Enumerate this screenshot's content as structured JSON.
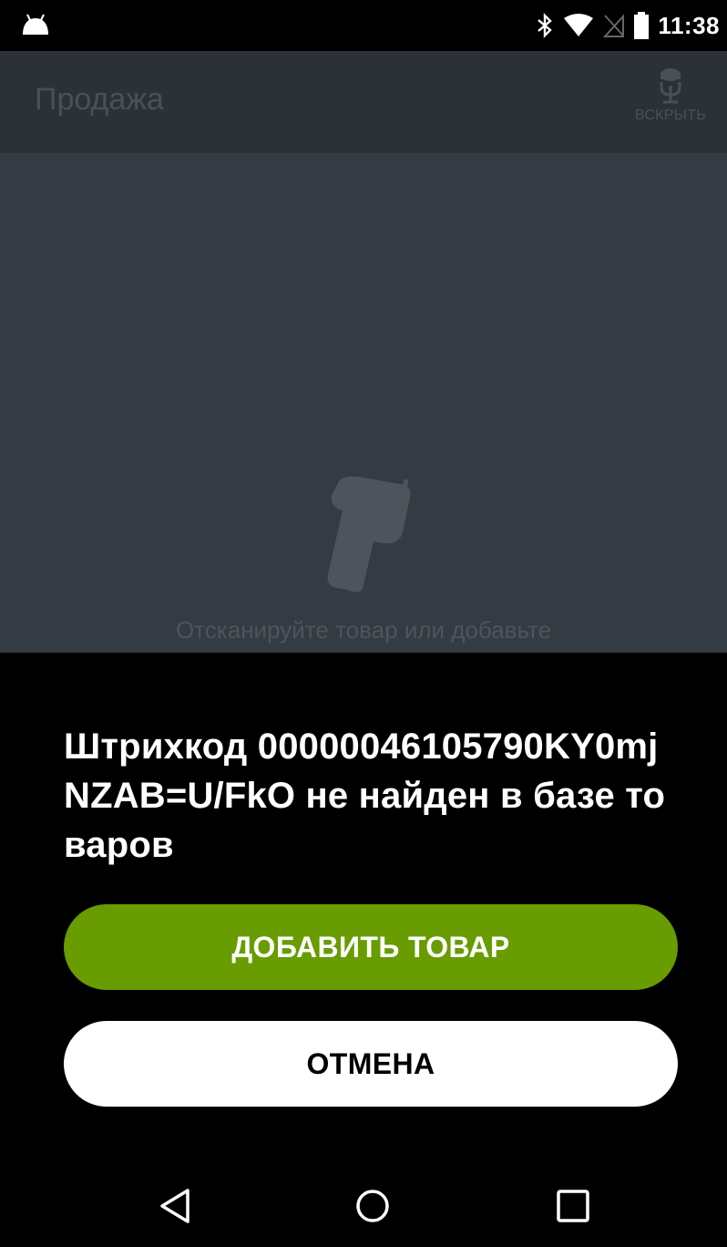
{
  "status_bar": {
    "time": "11:38",
    "icons": [
      "android-icon",
      "bluetooth-icon",
      "wifi-icon",
      "no-sim-icon",
      "battery-icon"
    ]
  },
  "app_bar": {
    "title": "Продажа",
    "open_action_label": "ВСКРЫТЬ",
    "open_action_icon": "open-drawer-icon"
  },
  "content": {
    "empty_hint": "Отсканируйте товар или добавьте",
    "scanner_icon": "barcode-scanner-icon"
  },
  "dialog": {
    "message": "Штрихкод 00000046105790KY0mjNZAB=U/FkO не найден в базе товаров",
    "add_button_label": "ДОБАВИТЬ ТОВАР",
    "cancel_button_label": "ОТМЕНА"
  },
  "colors": {
    "accent_green": "#689c00",
    "app_bar_bg": "#2b3137",
    "content_bg": "#343b42",
    "dialog_bg": "#000000"
  },
  "nav_bar": {
    "icons": [
      "back-icon",
      "home-icon",
      "recents-icon"
    ]
  }
}
